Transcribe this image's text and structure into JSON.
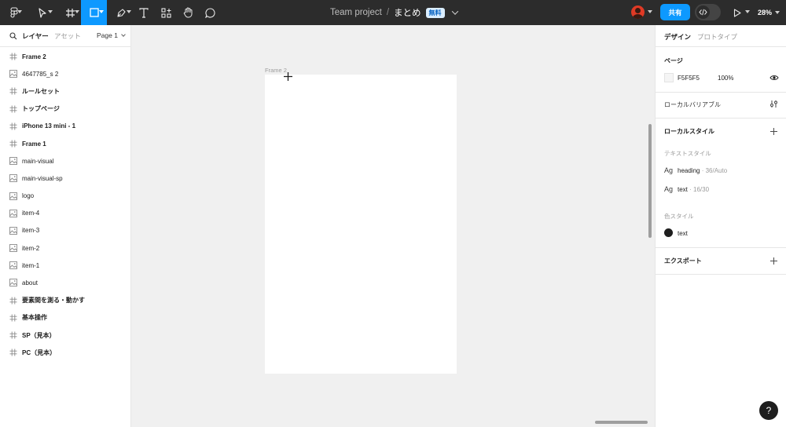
{
  "toolbar": {
    "main_menu_icon": "figma-logo-icon",
    "tools": [
      "move-tool-icon",
      "frame-tool-icon",
      "rectangle-tool-icon",
      "pen-tool-icon",
      "text-tool-icon",
      "actions-icon",
      "hand-tool-icon",
      "comment-tool-icon"
    ],
    "active_tool": "rectangle-tool-icon",
    "accent": "#0d99ff"
  },
  "file": {
    "project": "Team project",
    "separator": "/",
    "name": "まとめ",
    "plan_badge": "無料"
  },
  "header_right": {
    "share_label": "共有",
    "dev_mode_icon": "code-icon",
    "play_icon": "play-icon",
    "zoom": "28%"
  },
  "left_panel": {
    "tab_layers": "レイヤー",
    "tab_assets": "アセット",
    "page_select": "Page 1",
    "layers": [
      {
        "label": "Frame 2",
        "type": "frame"
      },
      {
        "label": "4647785_s 2",
        "type": "image"
      },
      {
        "label": "ルールセット",
        "type": "frame"
      },
      {
        "label": "トップページ",
        "type": "frame"
      },
      {
        "label": "iPhone 13 mini - 1",
        "type": "frame"
      },
      {
        "label": "Frame 1",
        "type": "frame"
      },
      {
        "label": "main-visual",
        "type": "image"
      },
      {
        "label": "main-visual-sp",
        "type": "image"
      },
      {
        "label": "logo",
        "type": "image"
      },
      {
        "label": "item-4",
        "type": "image"
      },
      {
        "label": "item-3",
        "type": "image"
      },
      {
        "label": "item-2",
        "type": "image"
      },
      {
        "label": "item-1",
        "type": "image"
      },
      {
        "label": "about",
        "type": "image"
      },
      {
        "label": "要素間を測る・動かす",
        "type": "frame"
      },
      {
        "label": "基本操作",
        "type": "frame"
      },
      {
        "label": "SP（見本）",
        "type": "frame"
      },
      {
        "label": "PC（見本）",
        "type": "frame"
      }
    ]
  },
  "canvas": {
    "frame_label": "Frame 2",
    "background": "#f0f0f0"
  },
  "right_panel": {
    "tab_design": "デザイン",
    "tab_prototype": "プロトタイプ",
    "page_title": "ページ",
    "page_color_hex": "F5F5F5",
    "page_opacity": "100%",
    "local_variables": "ローカルバリアブル",
    "local_styles": "ローカルスタイル",
    "text_styles_title": "テキストスタイル",
    "text_styles": [
      {
        "glyph": "Ag",
        "name": "heading",
        "meta": " · 36/Auto"
      },
      {
        "glyph": "Ag",
        "name": "text",
        "meta": " · 16/30"
      }
    ],
    "color_styles_title": "色スタイル",
    "color_styles": [
      {
        "name": "text",
        "color": "#1e1e1e"
      }
    ],
    "export": "エクスポート"
  },
  "help_label": "?"
}
